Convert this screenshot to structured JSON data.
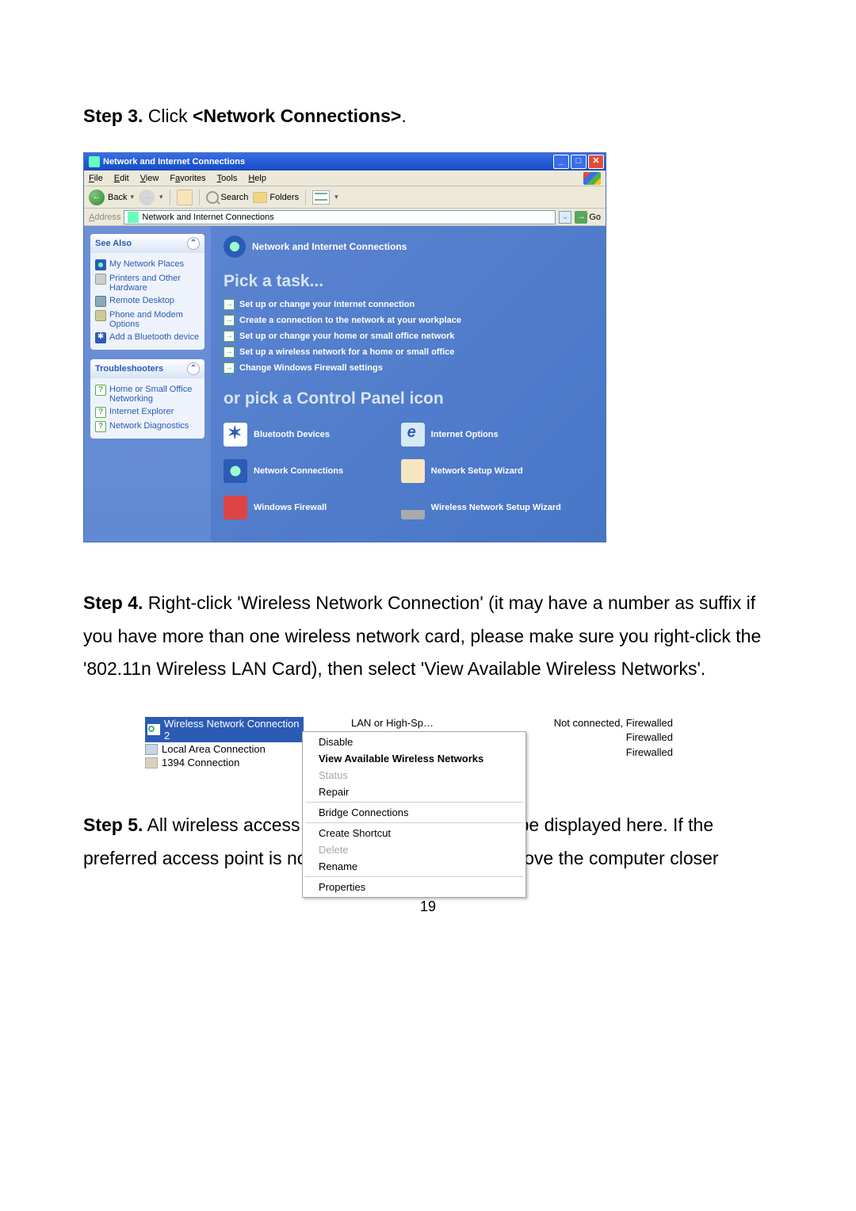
{
  "step3": {
    "prefix": "Step 3.",
    "text": " Click ",
    "bold": "<Network Connections>",
    "suffix": "."
  },
  "xp": {
    "title": "Network and Internet Connections",
    "menus": [
      {
        "u": "F",
        "rest": "ile"
      },
      {
        "u": "E",
        "rest": "dit"
      },
      {
        "u": "V",
        "rest": "iew"
      },
      {
        "u": "",
        "rest": "F",
        "u2": "a",
        "rest2": "vorites"
      },
      {
        "u": "T",
        "rest": "ools"
      },
      {
        "u": "H",
        "rest": "elp"
      }
    ],
    "toolbar": {
      "back": "Back",
      "search": "Search",
      "folders": "Folders"
    },
    "address": {
      "label": "Address",
      "value": "Network and Internet Connections",
      "go": "Go"
    },
    "sidebar": {
      "seeAlso": {
        "title": "See Also",
        "items": [
          {
            "icon": "globe",
            "label": "My Network Places"
          },
          {
            "icon": "printer",
            "label": "Printers and Other Hardware"
          },
          {
            "icon": "remote",
            "label": "Remote Desktop"
          },
          {
            "icon": "phone",
            "label": "Phone and Modem Options"
          },
          {
            "icon": "bt",
            "label": "Add a Bluetooth device"
          }
        ]
      },
      "trouble": {
        "title": "Troubleshooters",
        "items": [
          {
            "icon": "q",
            "label": "Home or Small Office Networking"
          },
          {
            "icon": "q",
            "label": "Internet Explorer"
          },
          {
            "icon": "q",
            "label": "Network Diagnostics"
          }
        ]
      }
    },
    "main": {
      "header": "Network and Internet Connections",
      "pick": "Pick a task...",
      "tasks": [
        "Set up or change your Internet connection",
        "Create a connection to the network at your workplace",
        "Set up or change your home or small office network",
        "Set up a wireless network for a home or small office",
        "Change Windows Firewall settings"
      ],
      "orPick": "or pick a Control Panel icon",
      "cpItems": [
        {
          "icon": "bt",
          "label": "Bluetooth Devices"
        },
        {
          "icon": "io",
          "label": "Internet Options"
        },
        {
          "icon": "net",
          "label": "Network Connections"
        },
        {
          "icon": "wiz",
          "label": "Network Setup Wizard"
        },
        {
          "icon": "fw",
          "label": "Windows Firewall"
        },
        {
          "icon": "wifi",
          "label": "Wireless Network Setup Wizard"
        }
      ]
    }
  },
  "step4": {
    "prefix": "Step 4.",
    "text": " Right-click 'Wireless Network Connection' (it may have a number as suffix if you have more than one wireless network card, please make sure you right-click the '802.11n Wireless LAN Card), then select 'View Available Wireless Networks'."
  },
  "ctx": {
    "connections": [
      {
        "icon": "wifi",
        "label": "Wireless Network Connection 2",
        "mid": "LAN or High-Sp…",
        "right": "Not connected, Firewalled",
        "selected": true
      },
      {
        "icon": "lan",
        "label": "Local Area Connection",
        "right": "Firewalled"
      },
      {
        "icon": "fw",
        "label": "1394 Connection",
        "right": "Firewalled"
      }
    ],
    "menu": [
      {
        "label": "Disable"
      },
      {
        "label": "View Available Wireless Networks",
        "bold": true
      },
      {
        "label": "Status",
        "disabled": true
      },
      {
        "label": "Repair"
      },
      {
        "sep": true
      },
      {
        "label": "Bridge Connections"
      },
      {
        "sep": true
      },
      {
        "label": "Create Shortcut"
      },
      {
        "label": "Delete",
        "disabled": true
      },
      {
        "label": "Rename"
      },
      {
        "sep": true
      },
      {
        "label": "Properties"
      }
    ]
  },
  "step5": {
    "prefix": "Step 5.",
    "text": " All wireless access points within proximity will be displayed here. If the preferred access point is not displayed, please try to move the computer closer"
  },
  "pageNumber": "19"
}
